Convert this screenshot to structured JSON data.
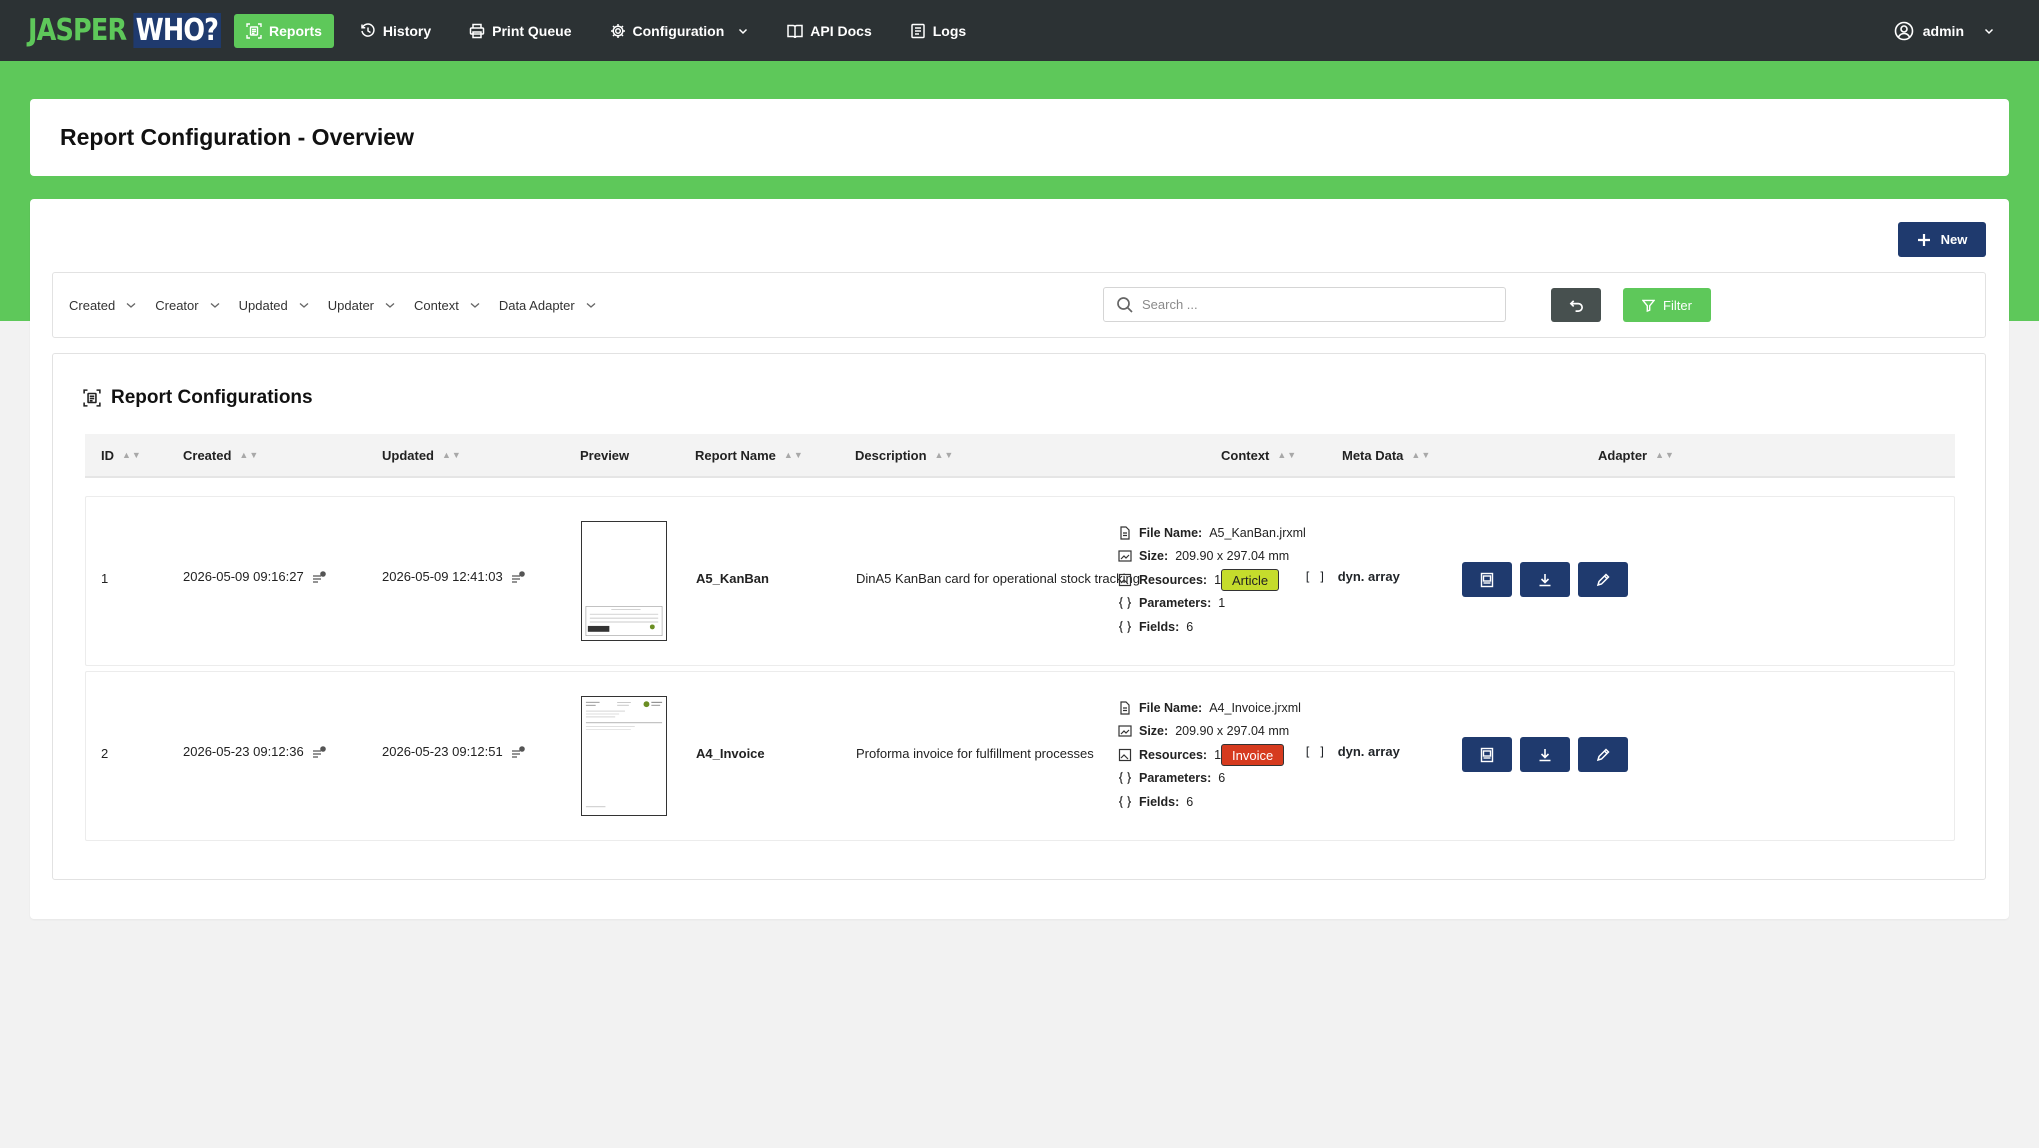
{
  "app": {
    "logo_part1": "JASPER",
    "logo_part2": "WHO?"
  },
  "nav": {
    "items": [
      {
        "label": "Reports",
        "icon": "reports-icon",
        "active": true
      },
      {
        "label": "History",
        "icon": "history-icon"
      },
      {
        "label": "Print Queue",
        "icon": "printer-icon"
      },
      {
        "label": "Configuration",
        "icon": "gear-icon"
      },
      {
        "label": "API Docs",
        "icon": "book-icon"
      },
      {
        "label": "Logs",
        "icon": "list-icon"
      }
    ],
    "user": "admin"
  },
  "page": {
    "title": "Report Configuration - Overview",
    "new_button": "New"
  },
  "filters": {
    "dropdowns": [
      "Created",
      "Creator",
      "Updated",
      "Updater",
      "Context",
      "Data Adapter"
    ],
    "search_placeholder": "Search ...",
    "filter_button": "Filter"
  },
  "table": {
    "title": "Report Configurations",
    "columns": [
      "ID",
      "Created",
      "Updated",
      "Preview",
      "Report Name",
      "Description",
      "Context",
      "Meta Data",
      "Adapter"
    ],
    "meta_labels": {
      "file_name": "File Name:",
      "size": "Size:",
      "resources": "Resources:",
      "parameters": "Parameters:",
      "fields": "Fields:"
    },
    "rows": [
      {
        "id": "1",
        "created": "2026-05-09 09:16:27",
        "updated": "2026-05-09 12:41:03",
        "name": "A5_KanBan",
        "description": "DinA5 KanBan card for operational stock tracking",
        "context": "Article",
        "file_name": "A5_KanBan.jrxml",
        "size": "209.90 x 297.04 mm",
        "resources": "1",
        "parameters": "1",
        "fields": "6",
        "adapter_brackets": "[ ]",
        "adapter": "dyn. array"
      },
      {
        "id": "2",
        "created": "2026-05-23 09:12:36",
        "updated": "2026-05-23 09:12:51",
        "name": "A4_Invoice",
        "description": "Proforma invoice for fulfillment processes",
        "context": "Invoice",
        "file_name": "A4_Invoice.jrxml",
        "size": "209.90 x 297.04 mm",
        "resources": "1",
        "parameters": "6",
        "fields": "6",
        "adapter_brackets": "[ ]",
        "adapter": "dyn. array"
      }
    ]
  },
  "colors": {
    "navbar": "#2c3234",
    "brand_green": "#5ec85a",
    "primary_blue": "#1f3a6e",
    "reset_gray": "#47504f",
    "badge_article": "#c5dc2c",
    "badge_invoice": "#d63b1f"
  }
}
